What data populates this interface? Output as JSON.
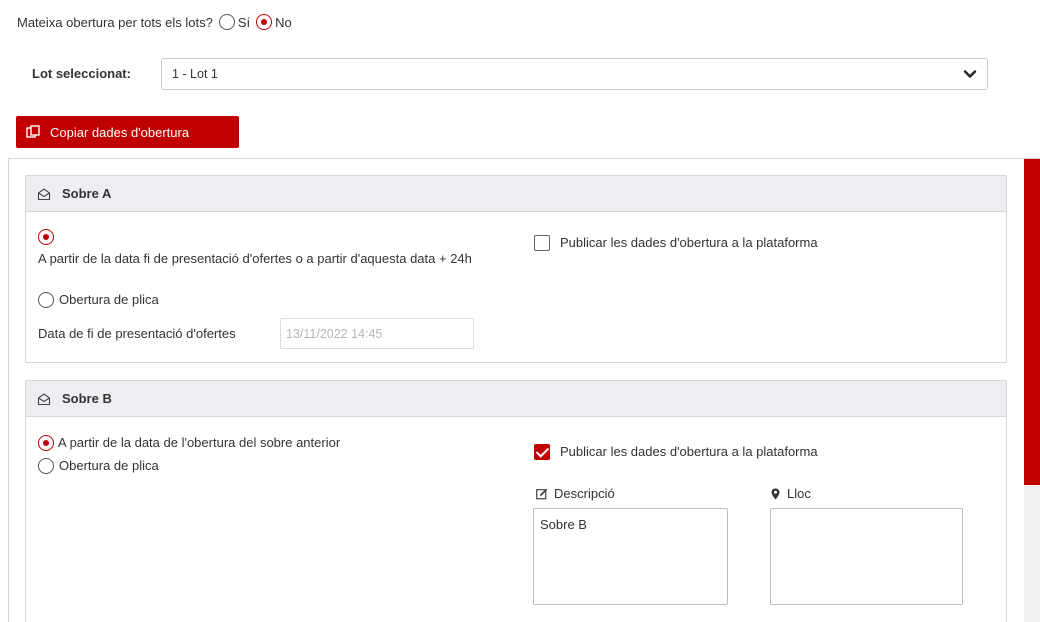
{
  "question": {
    "label": "Mateixa obertura per tots els lots?",
    "options": [
      "Sí",
      "No"
    ],
    "selected": "No"
  },
  "lot": {
    "label": "Lot seleccionat:",
    "value": "1 - Lot 1"
  },
  "copy_button": {
    "label": "Copiar dades d'obertura"
  },
  "sobre_a": {
    "title": "Sobre A",
    "option1": "A partir de la data fi de presentació d'ofertes o a partir d'aquesta data + 24h",
    "option2": "Obertura de plica",
    "publish_label": "Publicar les dades d'obertura a la plataforma",
    "publish_checked": false,
    "date_label": "Data de fi de presentació d'ofertes",
    "date_value": "13/11/2022 14:45"
  },
  "sobre_b": {
    "title": "Sobre B",
    "option1": "A partir de la data de l'obertura del sobre anterior",
    "option2": "Obertura de plica",
    "publish_label": "Publicar les dades d'obertura a la plataforma",
    "publish_checked": true,
    "descripcio_label": "Descripció",
    "descripcio_value": "Sobre B",
    "lloc_label": "Lloc",
    "lloc_value": ""
  },
  "colors": {
    "accent": "#c00000",
    "header_bg": "#eceef1",
    "border": "#d6d6d6"
  }
}
